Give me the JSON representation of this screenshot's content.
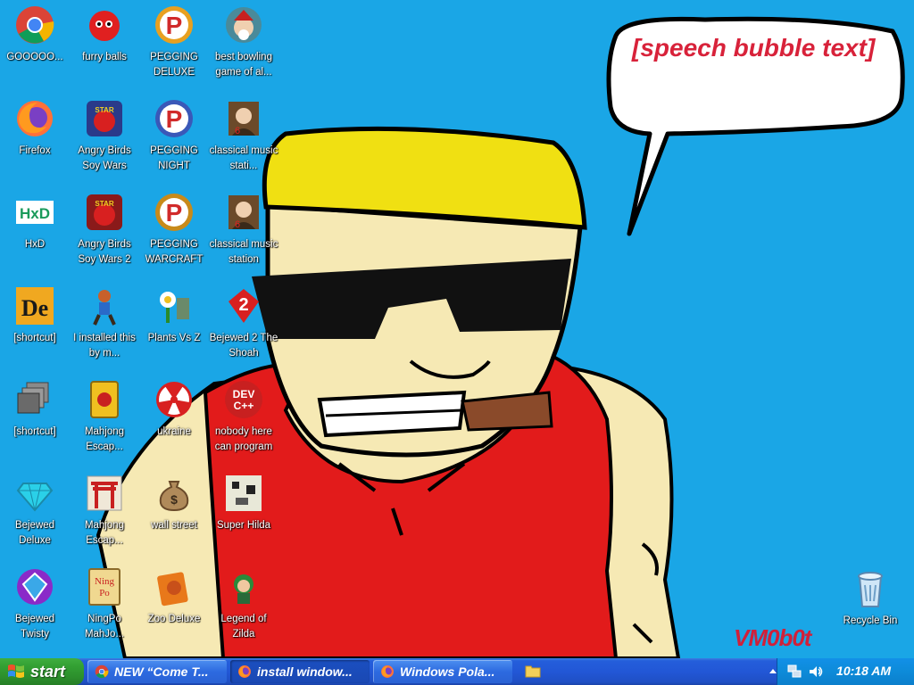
{
  "desktop": {
    "icons": [
      {
        "label": "GOOOOO...",
        "icon": "chrome-icon"
      },
      {
        "label": "furry balls",
        "icon": "red-fuzzball-icon"
      },
      {
        "label": "PEGGING DELUXE",
        "icon": "peggle-icon"
      },
      {
        "label": "best bowling game of al...",
        "icon": "bowling-santa-icon"
      },
      {
        "label": "Firefox",
        "icon": "firefox-icon"
      },
      {
        "label": "Angry Birds Soy Wars",
        "icon": "angry-birds-star-wars-icon"
      },
      {
        "label": "PEGGING NIGHT",
        "icon": "peggle-night-icon"
      },
      {
        "label": "classical music stati...",
        "icon": "classical-portrait-icon"
      },
      {
        "label": "HxD",
        "icon": "hxd-icon"
      },
      {
        "label": "Angry Birds Soy Wars 2",
        "icon": "angry-birds-star-wars-2-icon"
      },
      {
        "label": "PEGGING WARCRAFT",
        "icon": "peggle-warcraft-icon"
      },
      {
        "label": "classical music station",
        "icon": "classical-portrait-icon"
      },
      {
        "label": "[shortcut]",
        "icon": "de-icon"
      },
      {
        "label": "I installed this by m...",
        "icon": "runner-character-icon"
      },
      {
        "label": "Plants Vs Z",
        "icon": "plants-vs-zombies-icon"
      },
      {
        "label": "Bejewed 2 The Shoah",
        "icon": "bejeweled-2-icon"
      },
      {
        "label": "[shortcut]",
        "icon": "stacked-windows-icon"
      },
      {
        "label": "Mahjong Escap...",
        "icon": "mahjong-tile-icon"
      },
      {
        "label": "ukraine",
        "icon": "radiation-icon"
      },
      {
        "label": "nobody here can program",
        "icon": "dev-cpp-icon"
      },
      {
        "label": "Bejewed Deluxe",
        "icon": "diamond-icon"
      },
      {
        "label": "Mahjong Escap...",
        "icon": "torii-gate-icon"
      },
      {
        "label": "wall street",
        "icon": "money-bag-icon"
      },
      {
        "label": "Super Hilda",
        "icon": "pixel-game-icon"
      },
      {
        "label": "Bejewed Twisty",
        "icon": "bejeweled-twist-icon"
      },
      {
        "label": "NingPo MahJo...",
        "icon": "ningpo-mahjong-icon"
      },
      {
        "label": "Zoo Deluxe",
        "icon": "zoo-deluxe-icon"
      },
      {
        "label": "Legend of Zilda",
        "icon": "legend-of-zelda-icon"
      }
    ],
    "recycle_bin": {
      "label": "Recycle Bin",
      "icon": "recycle-bin-icon"
    },
    "wallpaper": {
      "speech_bubble": "[speech bubble text]",
      "signature": "VM0b0t"
    }
  },
  "taskbar": {
    "start_label": "start",
    "tasks": [
      {
        "label": "NEW “Come T...",
        "icon": "chrome-icon",
        "active": false
      },
      {
        "label": "install window...",
        "icon": "firefox-icon",
        "active": true
      },
      {
        "label": "Windows Pola...",
        "icon": "firefox-icon",
        "active": false
      }
    ],
    "quick_launch": {
      "icon": "folder-icon"
    },
    "tray": {
      "icons": [
        "show-hidden-arrow-icon",
        "network-icon",
        "volume-icon"
      ],
      "clock": "10:18 AM"
    }
  },
  "colors": {
    "desktop_bg": "#1aa6e6",
    "bubble_text": "#d8223a",
    "taskbar_blue": "#245edb",
    "start_green": "#33a033"
  }
}
